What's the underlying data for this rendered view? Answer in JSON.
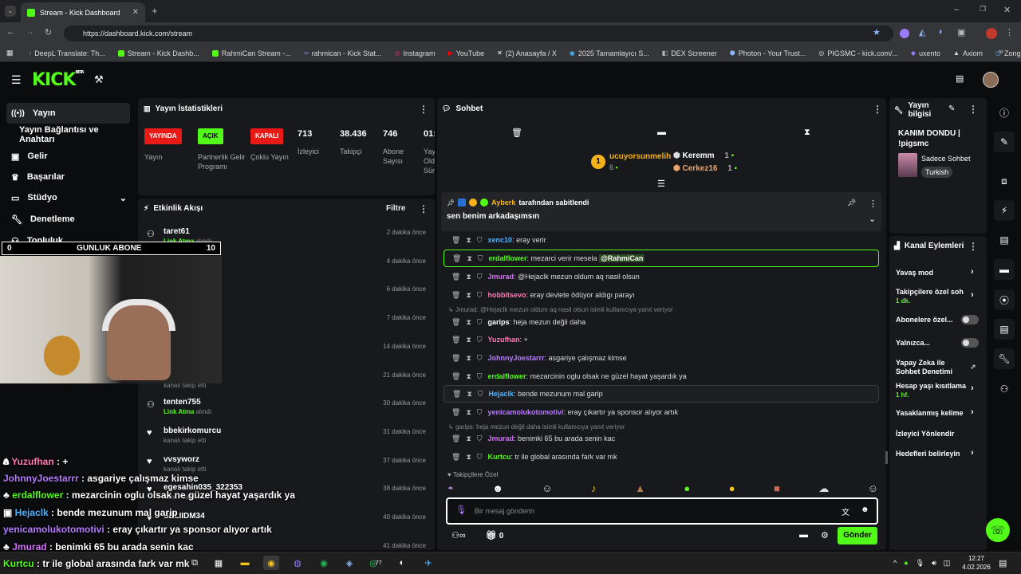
{
  "browser": {
    "tab_title": "Stream - Kick Dashboard",
    "url": "https://dashboard.kick.com/stream",
    "bookmarks": [
      "DeepL Translate: Th...",
      "Stream - Kick Dashb...",
      "RahmiCan Stream -...",
      "rahmican - Kick Stat...",
      "Instagram",
      "YouTube",
      "(2) Anasayfa / X",
      "2025 Tamamlayıcı S...",
      "DEX Screener",
      "Photon - Your Trust...",
      "PIGSMC - kick.com/...",
      "uxento",
      "Axiom",
      "Zonguldak İngilizce..."
    ]
  },
  "header": {
    "logo": "KICK",
    "logo_beta": "BETA"
  },
  "sidebar": {
    "items": [
      {
        "label": "Yayın",
        "icon": "broadcast-icon"
      },
      {
        "label": "Yayın Bağlantısı ve Anahtarı",
        "icon": ""
      },
      {
        "label": "Gelir",
        "icon": "wallet-icon"
      },
      {
        "label": "Başarılar",
        "icon": "trophy-icon"
      },
      {
        "label": "Stüdyo",
        "icon": "studio-icon"
      },
      {
        "label": "Denetleme",
        "icon": "wrench-icon"
      },
      {
        "label": "Topluluk",
        "icon": "community-icon"
      }
    ]
  },
  "stats": {
    "title": "Yayın İstatistikleri",
    "badges": [
      {
        "badge": "YAYINDA",
        "label": "Yayın",
        "color": "#e91916"
      },
      {
        "badge": "AÇIK",
        "label": "Partnerlik Gelir Programı",
        "color": "#53fc18"
      },
      {
        "badge": "KAPALI",
        "label": "Çoklu Yayın",
        "color": "#e91916"
      }
    ],
    "numbers": [
      {
        "value": "713",
        "label": "İzleyici"
      },
      {
        "value": "38.436",
        "label": "Takipçi"
      },
      {
        "value": "746",
        "label": "Abone Sayısı"
      },
      {
        "value": "01:",
        "label": "Yay Old Sür"
      }
    ]
  },
  "activity": {
    "title": "Etkinlik Akışı",
    "filter": "Filtre",
    "items": [
      {
        "name": "taret61",
        "sub_a": "Link Atma",
        "sub_b": "alındı",
        "time": "2 dakika önce",
        "icon": "link-icon"
      },
      {
        "name": "",
        "sub_a": "",
        "sub_b": "",
        "time": "4 dakika önce",
        "icon": ""
      },
      {
        "name": "",
        "sub_a": "",
        "sub_b": "",
        "time": "6 dakika önce",
        "icon": ""
      },
      {
        "name": "",
        "sub_a": "",
        "sub_b": "",
        "time": "7 dakika önce",
        "icon": ""
      },
      {
        "name": "",
        "sub_a": "",
        "sub_b": "",
        "time": "14 dakika önce",
        "icon": ""
      },
      {
        "name": "",
        "sub_a": "",
        "sub_b": "kanalı takip etti",
        "time": "21 dakika önce",
        "icon": ""
      },
      {
        "name": "tenten755",
        "sub_a": "Link Atma",
        "sub_b": "alındı",
        "time": "30 dakika önce",
        "icon": "link-icon"
      },
      {
        "name": "bbekirkomurcu",
        "sub_a": "",
        "sub_b": "kanalı takip etti",
        "time": "31 dakika önce",
        "icon": "heart-icon"
      },
      {
        "name": "vvsyworz",
        "sub_a": "",
        "sub_b": "kanalı takip etti",
        "time": "37 dakika önce",
        "icon": "heart-icon"
      },
      {
        "name": "egesahin035_322353",
        "sub_a": "",
        "sub_b": "kanalı takip etti",
        "time": "38 dakika önce",
        "icon": "heart-icon"
      },
      {
        "name": "SELIIDM34",
        "sub_a": "",
        "sub_b": "",
        "time": "40 dakika önce",
        "icon": "heart-icon"
      },
      {
        "name": "",
        "sub_a": "",
        "sub_b": "",
        "time": "41 dakika önce",
        "icon": ""
      }
    ]
  },
  "sub_goal": {
    "left": "0",
    "label": "GUNLUK ABONE",
    "right": "10"
  },
  "chat": {
    "title": "Sohbet",
    "top_gifter": {
      "rank": "1",
      "name": "ucuyorsunmelih",
      "count": "6"
    },
    "gifters": [
      {
        "name": "Keremm",
        "count": "1"
      },
      {
        "name": "Cerkez16",
        "count": "1"
      }
    ],
    "pinned": {
      "by": "Ayberk",
      "by_suffix": "tarafından sabitlendi",
      "text": "sen benim arkadaşımsın"
    },
    "messages": [
      {
        "user": "xenc10",
        "text": ": eray verir",
        "color": "#4fb3ff",
        "hl": false,
        "reply": ""
      },
      {
        "user": "erdalflower",
        "text": ": mezarci verir mesela ",
        "mention": "@RahmiCan",
        "color": "#53fc18",
        "hl": true,
        "reply": ""
      },
      {
        "user": "Jmurad",
        "text": ": @Hejaclk mezun oldum aq nasil olsun",
        "color": "#d66fff",
        "hl": false,
        "reply": ""
      },
      {
        "user": "hobbitsevo",
        "text": ": eray devlete ödüyor aldıgı parayı",
        "color": "#ff7ab6",
        "hl": false,
        "reply": ""
      },
      {
        "user": "garips",
        "text": ": heja mezun değil daha",
        "color": "#ffffff",
        "hl": false,
        "reply": "Jmurad: @Hejaclk mezun oldum aq nasil olsun isimli kullanıcıya yanıt veriyor"
      },
      {
        "user": "Yuzufhan",
        "text": ": +",
        "color": "#ff7ab6",
        "hl": false,
        "reply": ""
      },
      {
        "user": "JohnnyJoestarrr",
        "text": ": asgariye çalışmaz kimse",
        "color": "#b77bff",
        "hl": false,
        "reply": ""
      },
      {
        "user": "erdalflower",
        "text": ": mezarcinin oglu olsak ne güzel hayat yaşardık ya",
        "color": "#53fc18",
        "hl": false,
        "reply": ""
      },
      {
        "user": "Hejaclk",
        "text": ": bende mezunum mal garip",
        "color": "#4fb3ff",
        "hl": true,
        "reply": ""
      },
      {
        "user": "yenicamolukotomotivi",
        "text": ": eray çıkartır ya sponsor alıyor artık",
        "color": "#b77bff",
        "hl": false,
        "reply": ""
      },
      {
        "user": "Jmurad",
        "text": ": benimki 65 bu arada senin kac",
        "color": "#d66fff",
        "hl": false,
        "reply": "garips: heja mezun değil daha isimli kullanıcıya yanıt veriyor"
      },
      {
        "user": "Kurtcu",
        "text": ": tr ile global arasında fark var mk",
        "color": "#53fc18",
        "hl": false,
        "reply": ""
      }
    ],
    "emote_label": "Takipçilere Özel",
    "input_placeholder": "Bir mesaj gönderin",
    "points": "0",
    "send_label": "Gönder"
  },
  "stream_info": {
    "title": "Yayın bilgisi",
    "stream_title": "KANIM DONDU | !pigsmc",
    "category": "Sadece Sohbet",
    "tag": "Turkish"
  },
  "channel_actions": {
    "title": "Kanal Eylemleri",
    "items": [
      {
        "label": "Yavaş mod",
        "sub": "",
        "control": "chevron"
      },
      {
        "label": "Takipçilere özel soh",
        "sub": "1 dk.",
        "control": "chevron"
      },
      {
        "label": "Abonelere özel...",
        "sub": "",
        "control": "toggle"
      },
      {
        "label": "Yalnızca...",
        "sub": "",
        "control": "toggle"
      },
      {
        "label": "Yapay Zeka ile Sohbet Denetimi",
        "sub": "",
        "control": "external"
      },
      {
        "label": "Hesap yaşı kısıtlama",
        "sub": "1 hf.",
        "control": "chevron"
      },
      {
        "label": "Yasaklanmış kelime",
        "sub": "",
        "control": "chevron"
      },
      {
        "label": "İzleyici Yönlendir",
        "sub": "",
        "control": ""
      },
      {
        "label": "Hedefleri belirleyin",
        "sub": "",
        "control": "chevron"
      }
    ]
  },
  "overlay_chat": [
    {
      "user": "Yuzufhan",
      "text": " : +",
      "color": "#ff7ab6"
    },
    {
      "user": "JohnnyJoestarrr",
      "text": " : asgariye çalışmaz kimse",
      "color": "#b77bff"
    },
    {
      "user": "erdalflower",
      "text": " : mezarcinin oglu olsak ne güzel hayat yaşardık ya",
      "color": "#53fc18"
    },
    {
      "user": "Hejaclk",
      "text": " : bende mezunum mal garip",
      "color": "#4fb3ff"
    },
    {
      "user": "yenicamolukotomotivi",
      "text": " : eray çıkartır ya sponsor alıyor artık",
      "color": "#b77bff"
    },
    {
      "user": "Jmurad",
      "text": " : benimki 65 bu arada senin kac",
      "color": "#d66fff"
    },
    {
      "user": "Kurtcu",
      "text": " : tr ile global arasında fark var mk",
      "color": "#53fc18"
    }
  ],
  "taskbar": {
    "time": "12:27",
    "date": "4.02.2026",
    "whatsapp_badge": "77"
  }
}
